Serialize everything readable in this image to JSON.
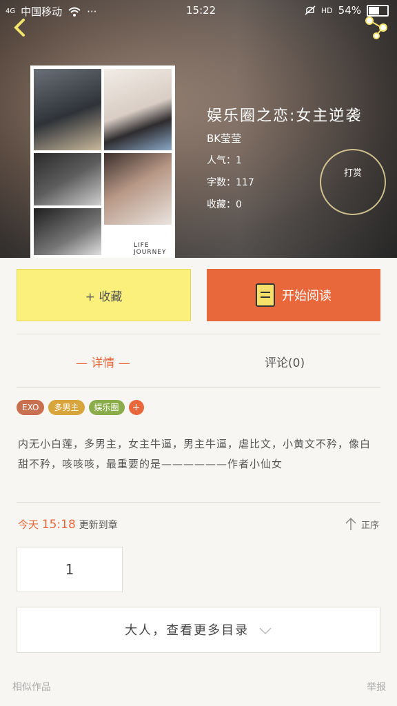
{
  "status_bar": {
    "network": "4G",
    "carrier": "中国移动",
    "more": "···",
    "time": "15:22",
    "hd": "HD",
    "battery": "54%"
  },
  "book": {
    "title": "娱乐圈之恋:女主逆袭",
    "author": "BK莹莹",
    "popularity": "人气：1",
    "word_count": "字数：117",
    "favorites": "收藏：0",
    "cover_caption": "LIFE JOURNEY",
    "tip_icon": "",
    "tip_label": "打赏"
  },
  "actions": {
    "favorite_label": "+ 收藏",
    "read_label": "开始阅读"
  },
  "tabs": {
    "detail": "— 详情 —",
    "comments": "评论(0)"
  },
  "tags": [
    {
      "label": "EXO",
      "color": "#c8704f"
    },
    {
      "label": "多男主",
      "color": "#d8a53c"
    },
    {
      "label": "娱乐圈",
      "color": "#8aac4a"
    }
  ],
  "tag_add": "+",
  "description": "内无小白莲，多男主，女主牛逼，男主牛逼，虐比文，小黄文不矜，像白甜不矜，咳咳咳，最重要的是——————作者小仙女",
  "update": {
    "prefix": "今天",
    "time": "15:18",
    "suffix": "更新到章"
  },
  "sort_label": "正序",
  "chapter": "1",
  "more_label": "大人，查看更多目录",
  "footer": {
    "similar": "相似作品",
    "report": "举报"
  }
}
